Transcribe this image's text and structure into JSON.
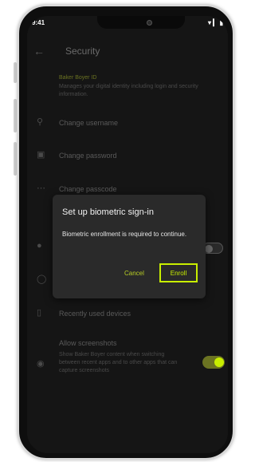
{
  "statusbar": {
    "time": "9:41",
    "icons": "▾ ▎ ▮"
  },
  "appbar": {
    "back_glyph": "←",
    "title": "Security"
  },
  "profile": {
    "title": "Baker Boyer ID",
    "description": "Manages your digital identity including login and security information."
  },
  "rows": {
    "change_username": "Change username",
    "change_password": "Change password",
    "change_passcode": "Change passcode",
    "recent_devices": "Recently used devices",
    "allow_screenshots": "Allow screenshots",
    "allow_screenshots_desc": "Show Baker Boyer content when switching between recent apps and to other apps that can capture screenshots"
  },
  "dialog": {
    "title": "Set up biometric sign-in",
    "body": "Biometric enrollment is required to continue.",
    "cancel": "Cancel",
    "enroll": "Enroll"
  },
  "colors": {
    "accent": "#c8ee00",
    "accent_dim": "#6b7322",
    "background": "#151515"
  }
}
